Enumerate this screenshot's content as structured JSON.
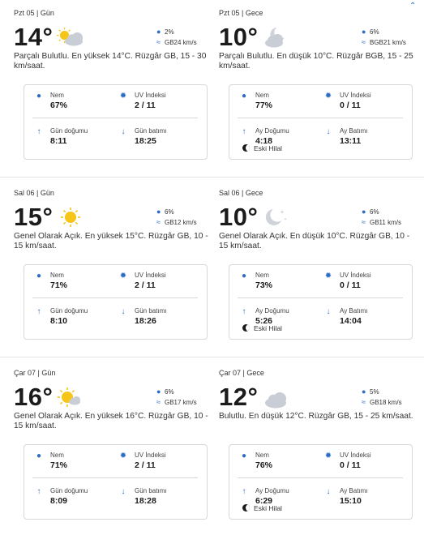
{
  "days": [
    {
      "day": {
        "header": "Pzt 05 | Gün",
        "temp": "14°",
        "icon": "partly-cloudy-sun-icon",
        "rain": "2%",
        "wind": "GB24 km/s",
        "desc": "Parçalı Bulutlu. En yüksek 14°C. Rüzgâr GB, 15 - 30 km/saat.",
        "humidity_label": "Nem",
        "humidity": "67%",
        "uv_label": "UV İndeksi",
        "uv": "2 / 11",
        "rise_label": "Gün doğumu",
        "rise": "8:11",
        "set_label": "Gün batımı",
        "set": "18:25"
      },
      "night": {
        "header": "Pzt 05 | Gece",
        "temp": "10°",
        "icon": "partly-cloudy-moon-icon",
        "rain": "6%",
        "wind": "BGB21 km/s",
        "desc": "Parçalı Bulutlu. En düşük 10°C. Rüzgâr BGB, 15 - 25 km/saat.",
        "humidity_label": "Nem",
        "humidity": "77%",
        "uv_label": "UV İndeksi",
        "uv": "0 / 11",
        "rise_label": "Ay Doğumu",
        "rise": "4:18",
        "set_label": "Ay Batımı",
        "set": "13:11",
        "moon_phase": "Eski Hilal"
      }
    },
    {
      "day": {
        "header": "Sal 06 | Gün",
        "temp": "15°",
        "icon": "sun-icon",
        "rain": "6%",
        "wind": "GB12 km/s",
        "desc": "Genel Olarak Açık. En yüksek 15°C. Rüzgâr GB, 10 - 15 km/saat.",
        "humidity_label": "Nem",
        "humidity": "71%",
        "uv_label": "UV İndeksi",
        "uv": "2 / 11",
        "rise_label": "Gün doğumu",
        "rise": "8:10",
        "set_label": "Gün batımı",
        "set": "18:26"
      },
      "night": {
        "header": "Sal 06 | Gece",
        "temp": "10°",
        "icon": "moon-stars-icon",
        "rain": "6%",
        "wind": "GB11 km/s",
        "desc": "Genel Olarak Açık. En düşük 10°C. Rüzgâr GB, 10 - 15 km/saat.",
        "humidity_label": "Nem",
        "humidity": "73%",
        "uv_label": "UV İndeksi",
        "uv": "0 / 11",
        "rise_label": "Ay Doğumu",
        "rise": "5:26",
        "set_label": "Ay Batımı",
        "set": "14:04",
        "moon_phase": "Eski Hilal"
      }
    },
    {
      "day": {
        "header": "Çar 07 | Gün",
        "temp": "16°",
        "icon": "mostly-sunny-icon",
        "rain": "6%",
        "wind": "GB17 km/s",
        "desc": "Genel Olarak Açık. En yüksek 16°C. Rüzgâr GB, 10 - 15 km/saat.",
        "humidity_label": "Nem",
        "humidity": "71%",
        "uv_label": "UV İndeksi",
        "uv": "2 / 11",
        "rise_label": "Gün doğumu",
        "rise": "8:09",
        "set_label": "Gün batımı",
        "set": "18:28"
      },
      "night": {
        "header": "Çar 07 | Gece",
        "temp": "12°",
        "icon": "cloud-icon",
        "rain": "5%",
        "wind": "GB18 km/s",
        "desc": "Bulutlu. En düşük 12°C. Rüzgâr GB, 15 - 25 km/saat.",
        "humidity_label": "Nem",
        "humidity": "76%",
        "uv_label": "UV İndeksi",
        "uv": "0 / 11",
        "rise_label": "Ay Doğumu",
        "rise": "6:29",
        "set_label": "Ay Batımı",
        "set": "15:10",
        "moon_phase": "Eski Hilal"
      }
    }
  ],
  "colors": {
    "accent": "#2b6cc4",
    "sun": "#f5c518",
    "cloud": "#c9ced6",
    "border": "#d8d8d8"
  }
}
